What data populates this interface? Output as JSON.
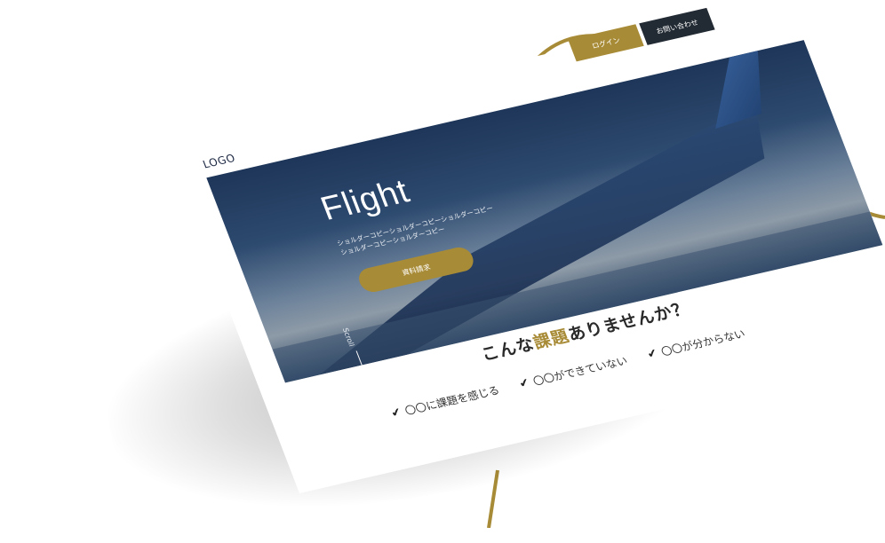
{
  "colors": {
    "accent": "#a88b36",
    "dark_button": "#222a33",
    "heading": "#2a2a2a",
    "logo": "#1f2a44"
  },
  "header": {
    "logo": "LOGO",
    "login_label": "ログイン",
    "contact_label": "お問い合わせ"
  },
  "hero": {
    "title": "Flight",
    "copy_line1": "ショルダーコピーショルダーコピーショルダーコピー",
    "copy_line2": "ショルダーコピーショルダーコピー",
    "cta_label": "資料請求",
    "scroll_label": "Scroll"
  },
  "issues": {
    "heading_before": "こんな",
    "heading_highlight": "課題",
    "heading_after": "ありませんか？",
    "items": [
      {
        "icon": "check-icon",
        "label": "〇〇に課題を感じる"
      },
      {
        "icon": "check-icon",
        "label": "〇〇ができていない"
      },
      {
        "icon": "check-icon",
        "label": "〇〇が分からない"
      }
    ]
  }
}
